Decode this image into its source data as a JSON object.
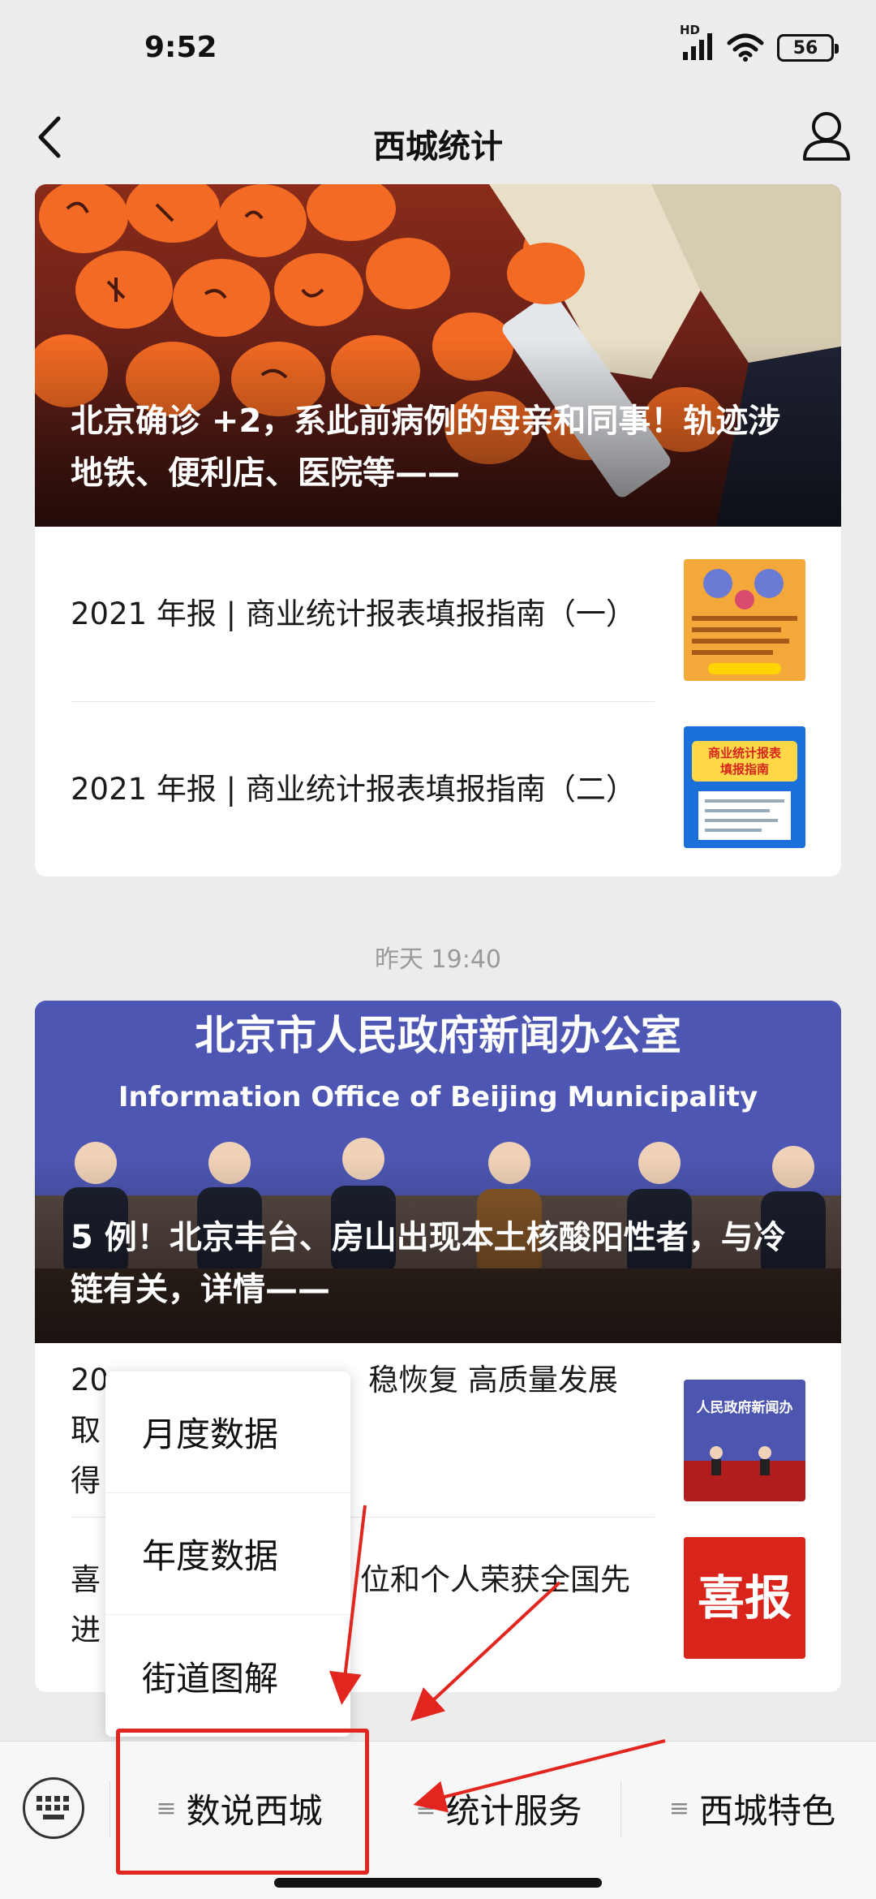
{
  "status_bar": {
    "time": "9:52",
    "hd": "HD",
    "battery": "56"
  },
  "nav": {
    "title": "西城统计"
  },
  "card1": {
    "hero_title": "北京确诊 +2，系此前病例的母亲和同事！轨迹涉地铁、便利店、医院等——",
    "items": [
      {
        "title": "2021 年报 | 商业统计报表填报指南（一）"
      },
      {
        "title": "2021 年报 | 商业统计报表填报指南（二）",
        "thumb_line1": "商业统计报表",
        "thumb_line2": "填报指南"
      }
    ]
  },
  "timestamp": "昨天 19:40",
  "card2": {
    "hero_banner_cn": "北京市人民政府新闻办公室",
    "hero_banner_en": "Information Office of Beijing Municipality",
    "hero_title": "5 例！北京丰台、房山出现本土核酸阳性者，与冷链有关，详情——",
    "items": [
      {
        "title_visible": "20",
        "title_visible_2": "稳恢复 高质量发展取",
        "title_line2": "得",
        "thumb_text": "人民政府新闻办"
      },
      {
        "title_visible": "喜",
        "title_visible_2": "位和个人荣获全国先",
        "title_line2": "进",
        "thumb_text": "喜报"
      }
    ]
  },
  "popup_menu": {
    "items": [
      "月度数据",
      "年度数据",
      "街道图解"
    ]
  },
  "bottom_menu": {
    "tabs": [
      "数说西城",
      "统计服务",
      "西城特色"
    ]
  },
  "colors": {
    "annotation": "#e3251f",
    "hero_red": "#8a2b1a",
    "hero_blue": "#4b55b0"
  }
}
